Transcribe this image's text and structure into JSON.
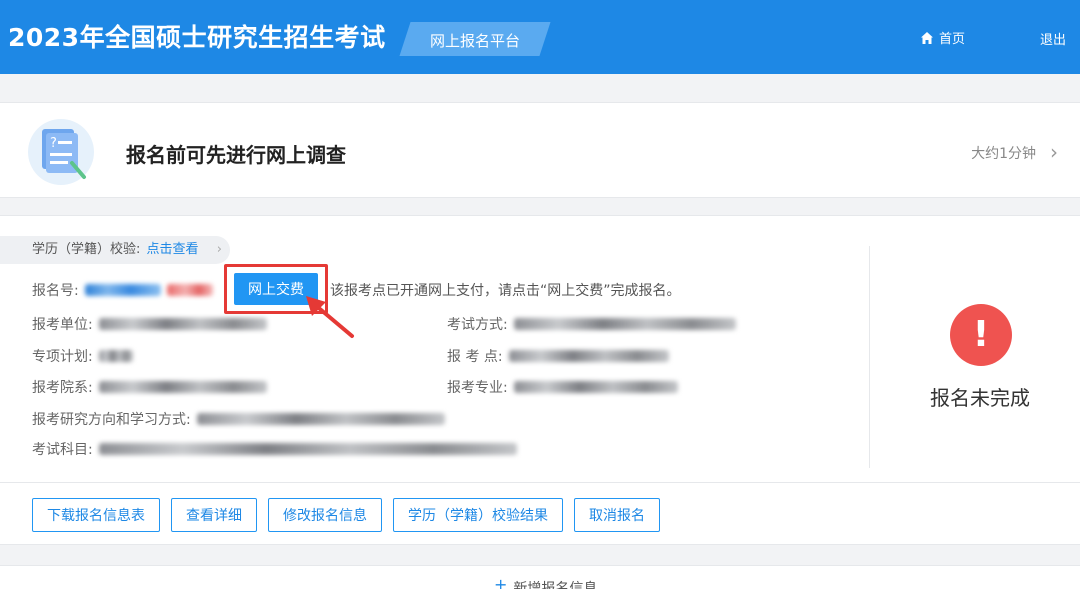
{
  "header": {
    "title": "2023年全国硕士研究生招生考试",
    "platform": "网上报名平台",
    "home_label": "首页",
    "logout_label": "退出",
    "home_icon": "home-icon"
  },
  "survey": {
    "title": "报名前可先进行网上调查",
    "time": "大约1分钟",
    "icon": "survey-document-icon",
    "chevron_icon": "chevron-right-icon"
  },
  "registration": {
    "verify_label": "学历（学籍）校验:",
    "verify_link": "点击查看",
    "reg_no_label": "报名号:",
    "pay_button": "网上交费",
    "pay_note": "该报考点已开通网上支付，请点击“网上交费”完成报名。",
    "fields": {
      "unit": "报考单位:",
      "exam_method": "考试方式:",
      "special_plan": "专项计划:",
      "exam_site": "报 考 点:",
      "department": "报考院系:",
      "major": "报考专业:",
      "direction": "报考研究方向和学习方式:",
      "subjects": "考试科目:"
    },
    "status_icon": "exclamation-icon",
    "status_symbol": "!",
    "status_text": "报名未完成",
    "actions": [
      "下载报名信息表",
      "查看详细",
      "修改报名信息",
      "学历（学籍）校验结果",
      "取消报名"
    ]
  },
  "add_new": {
    "label": "新增报名信息",
    "icon": "plus-icon"
  },
  "colors": {
    "header_bg": "#1e88e5",
    "primary": "#2196f3",
    "danger": "#ef5350",
    "highlight": "#e53935"
  }
}
